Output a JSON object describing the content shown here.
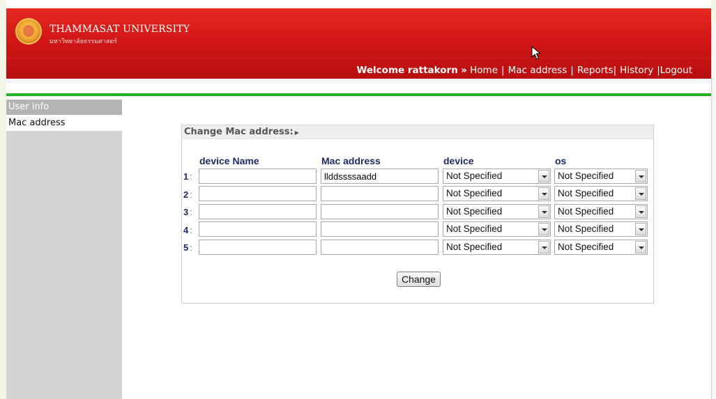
{
  "header": {
    "university_name": "THAMMASAT UNIVERSITY",
    "university_subtitle": "มหาวิทยาลัยธรรมศาสตร์",
    "welcome": "Welcome rattakorn",
    "welcome_sep": "»",
    "nav": {
      "home": "Home",
      "mac_address": "Mac address",
      "reports": "Reports",
      "history": "History",
      "logout": "Logout"
    }
  },
  "sidebar": {
    "heading": "User info",
    "items": [
      {
        "label": "Mac address"
      }
    ]
  },
  "form": {
    "title": "Change  Mac address:",
    "columns": {
      "device_name": "device Name",
      "mac_address": "Mac address",
      "device": "device",
      "os": "os"
    },
    "rows": [
      {
        "num": "1",
        "sep": ":",
        "device_name": "",
        "mac": "llddssssaadd",
        "device": "Not Specified",
        "os": "Not Specified"
      },
      {
        "num": "2",
        "sep": ":",
        "device_name": "",
        "mac": "",
        "device": "Not Specified",
        "os": "Not Specified"
      },
      {
        "num": "3",
        "sep": ":",
        "device_name": "",
        "mac": "",
        "device": "Not Specified",
        "os": "Not Specified"
      },
      {
        "num": "4",
        "sep": ":",
        "device_name": "",
        "mac": "",
        "device": "Not Specified",
        "os": "Not Specified"
      },
      {
        "num": "5",
        "sep": ":",
        "device_name": "",
        "mac": "",
        "device": "Not Specified",
        "os": "Not Specified"
      }
    ],
    "submit_label": "Change"
  },
  "colors": {
    "header_red": "#d21616",
    "accent_green": "#22b322",
    "label_blue": "#1f2a6b"
  }
}
